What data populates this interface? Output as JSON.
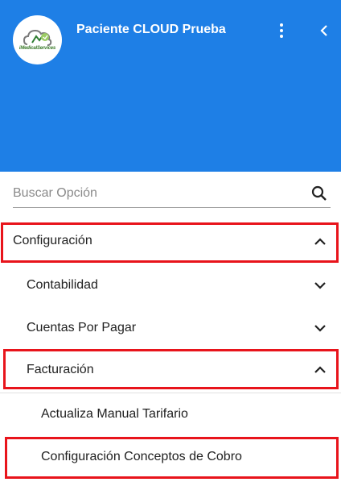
{
  "header": {
    "logo_text": "iMedicalServices",
    "user_name": "Paciente CLOUD Prueba",
    "more_icon": "more-vert-icon",
    "collapse_icon": "chevron-left-icon"
  },
  "search": {
    "placeholder": "Buscar Opción",
    "icon": "search-icon"
  },
  "menu": [
    {
      "label": "Configuración",
      "expanded": true,
      "level": 0,
      "highlighted": true
    },
    {
      "label": "Contabilidad",
      "expanded": false,
      "level": 1,
      "highlighted": false
    },
    {
      "label": "Cuentas Por Pagar",
      "expanded": false,
      "level": 1,
      "highlighted": false
    },
    {
      "label": "Facturación",
      "expanded": true,
      "level": 1,
      "highlighted": true
    },
    {
      "label": "Actualiza Manual Tarifario",
      "level": 2,
      "highlighted": false
    },
    {
      "label": "Configuración Conceptos de Cobro",
      "level": 2,
      "highlighted": true
    }
  ],
  "colors": {
    "header_bg": "#1e7fe6",
    "highlight": "#e8141b"
  }
}
